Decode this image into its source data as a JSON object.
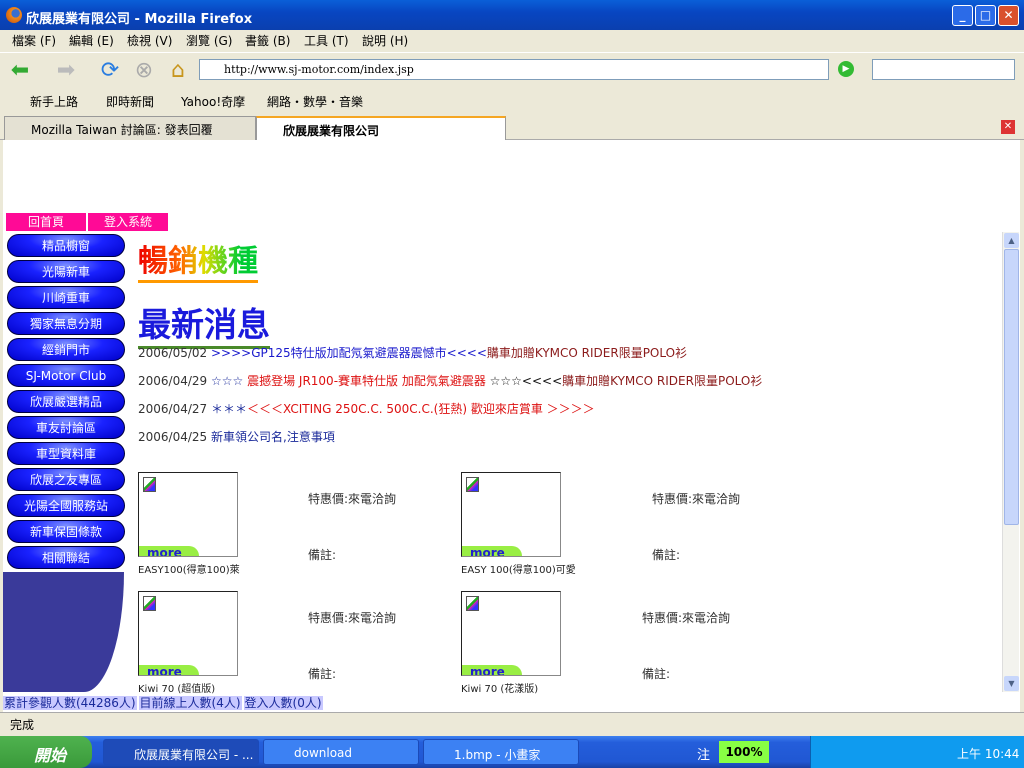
{
  "window": {
    "title": "欣展展業有限公司 - Mozilla Firefox"
  },
  "menu": [
    "檔案 (F)",
    "編輯 (E)",
    "檢視 (V)",
    "瀏覽 (G)",
    "書籤 (B)",
    "工具 (T)",
    "說明 (H)"
  ],
  "url": "http://www.sj-motor.com/index.jsp",
  "bookmarks": [
    "新手上路",
    "即時新聞",
    "Yahoo!奇摩",
    "網路・數學・音樂"
  ],
  "tabs": [
    "Mozilla Taiwan 討論區: 發表回覆",
    "欣展展業有限公司"
  ],
  "top_links": [
    "回首頁",
    "登入系統"
  ],
  "sidebar": [
    "精品櫥窗",
    "光陽新車",
    "川崎重車",
    "獨家無息分期",
    "經銷門市",
    "SJ-Motor Club",
    "欣展嚴選精品",
    "車友討論區",
    "車型資料庫",
    "欣展之友專區",
    "光陽全國服務站",
    "新車保固條款",
    "相關聯結"
  ],
  "headings": {
    "hot": "暢銷機種",
    "news": "最新消息"
  },
  "news": [
    {
      "date": "2006/05/02",
      "parts": [
        {
          "t": ">>>>GP125特仕版加配氖氣避震器震憾市<<<<",
          "c": "#1a1acc"
        },
        {
          "t": "購車加贈KYMCO RIDER限量POLO衫",
          "c": "#8b1a1a"
        }
      ]
    },
    {
      "date": "2006/04/29",
      "parts": [
        {
          "t": "☆☆☆ ",
          "c": "#1a2a9a"
        },
        {
          "t": "震撼登場 JR100-賽車特仕版 加配氖氣避震器 ",
          "c": "#dd1111"
        },
        {
          "t": "☆☆☆<<<<",
          "c": "#111"
        },
        {
          "t": "購車加贈KYMCO RIDER限量POLO衫",
          "c": "#8b1a1a"
        }
      ]
    },
    {
      "date": "2006/04/27",
      "parts": [
        {
          "t": "＊＊＊",
          "c": "#1a2a9a"
        },
        {
          "t": "＜＜＜XCITING 250C.C. 500C.C.(狂熱) 歡迎來店賞車 ＞＞＞＞",
          "c": "#dd1111"
        }
      ]
    },
    {
      "date": "2006/04/25",
      "parts": [
        {
          "t": "新車領公司名,注意事項",
          "c": "#1a2a9a"
        }
      ]
    }
  ],
  "products": [
    {
      "name": "EASY100(得意100)萊",
      "price": "特惠價:來電洽詢",
      "note": "備註:",
      "more": "more"
    },
    {
      "name": "EASY 100(得意100)可愛",
      "price": "特惠價:來電洽詢",
      "note": "備註:",
      "more": "more"
    },
    {
      "name": "Kiwi 70 (超值版)",
      "price": "特惠價:來電洽詢",
      "note": "備註:",
      "more": "more"
    },
    {
      "name": "Kiwi 70 (花漾版)",
      "price": "特惠價:來電洽詢",
      "note": "備註:",
      "more": "more"
    }
  ],
  "counter": [
    "累計參觀人數(44286人)",
    "目前線上人數(4人)",
    "登入人數(0人)"
  ],
  "status": "完成",
  "taskbar": {
    "start": "開始",
    "tasks": [
      "欣展展業有限公司 - ...",
      "download",
      "1.bmp - 小畫家"
    ],
    "ime": "注",
    "battery": "100%",
    "clock": "上午 10:44"
  }
}
